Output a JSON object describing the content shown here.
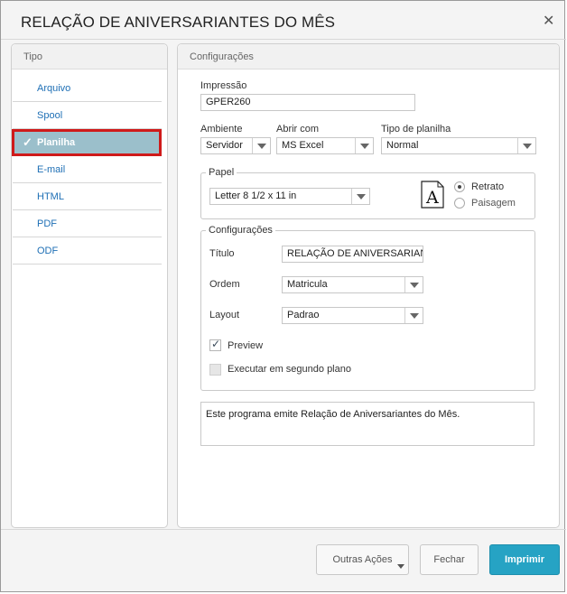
{
  "dialog": {
    "title": "RELAÇÃO DE ANIVERSARIANTES DO MÊS",
    "close_glyph": "✕"
  },
  "tipo": {
    "header": "Tipo",
    "items": [
      {
        "label": "Arquivo",
        "active": false
      },
      {
        "label": "Spool",
        "active": false
      },
      {
        "label": "Planilha",
        "active": true
      },
      {
        "label": "E-mail",
        "active": false
      },
      {
        "label": "HTML",
        "active": false
      },
      {
        "label": "PDF",
        "active": false
      },
      {
        "label": "ODF",
        "active": false
      }
    ],
    "check_glyph": "✓"
  },
  "config": {
    "header": "Configurações",
    "impressao": {
      "label": "Impressão",
      "value": "GPER260"
    },
    "ambiente": {
      "label": "Ambiente",
      "value": "Servidor"
    },
    "abrir_com": {
      "label": "Abrir com",
      "value": "MS Excel"
    },
    "tipo_planilha": {
      "label": "Tipo de planilha",
      "value": "Normal"
    },
    "papel": {
      "legend": "Papel",
      "size": "Letter 8 1/2 x 11 in",
      "preview_letter": "A",
      "retrato": "Retrato",
      "paisagem": "Paisagem",
      "orientation": "Retrato"
    },
    "configuracoes": {
      "legend": "Configurações",
      "titulo_label": "Título",
      "titulo_value": "RELAÇÃO DE ANIVERSARIANTES DO MÊS",
      "ordem_label": "Ordem",
      "ordem_value": "Matricula",
      "layout_label": "Layout",
      "layout_value": "Padrao",
      "preview_label": "Preview",
      "preview_checked": true,
      "segundo_plano_label": "Executar em segundo plano",
      "segundo_plano_checked": false
    },
    "description": "Este programa emite Relação de Aniversariantes do Mês."
  },
  "footer": {
    "outras_acoes": "Outras Ações",
    "fechar": "Fechar",
    "imprimir": "Imprimir"
  },
  "colors": {
    "primary_button": "#26a3c4",
    "active_item_bg": "#9bbfcb",
    "highlight_border": "#cf1a1a",
    "link": "#1e6fb5"
  }
}
